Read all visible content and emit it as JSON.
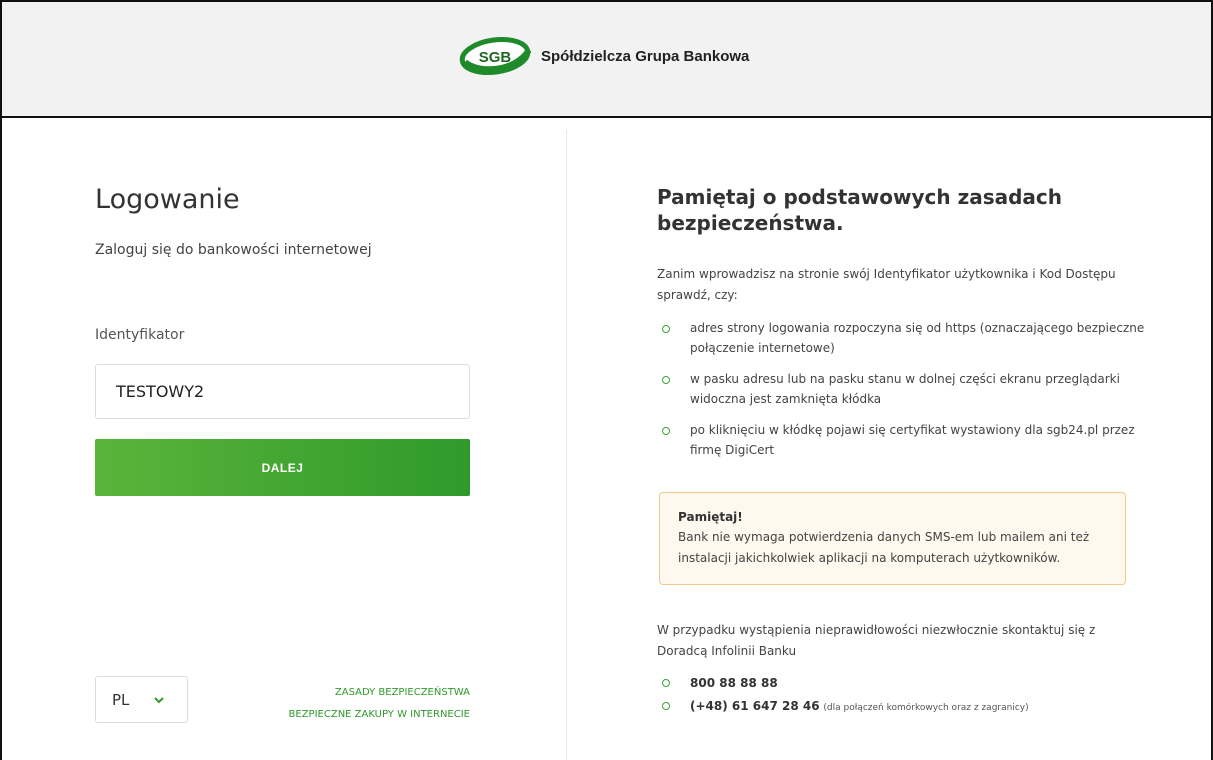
{
  "header": {
    "brand_logo_text": "SGB",
    "brand_name": "Spółdzielcza Grupa Bankowa"
  },
  "login": {
    "title": "Logowanie",
    "subtitle": "Zaloguj się do bankowości internetowej",
    "identifier_label": "Identyfikator",
    "identifier_value": "TESTOWY2",
    "submit_label": "DALEJ"
  },
  "language": {
    "selected": "PL",
    "chevron_icon": "chevron-down-icon"
  },
  "footer_links": [
    "ZASADY BEZPIECZEŃSTWA",
    "BEZPIECZNE ZAKUPY W INTERNECIE"
  ],
  "security": {
    "title": "Pamiętaj o podstawowych zasadach bezpieczeństwa.",
    "intro": "Zanim wprowadzisz na stronie swój Identyfikator użytkownika i Kod Dostępu sprawdź, czy:",
    "checks": [
      "adres strony logowania rozpoczyna się od https (oznaczającego bezpieczne połączenie internetowe)",
      "w pasku adresu lub na pasku stanu w dolnej części ekranu przeglądarki widoczna jest zamknięta kłódka",
      "po kliknięciu w kłódkę pojawi się certyfikat wystawiony dla sgb24.pl przez firmę DigiCert"
    ],
    "notice_title": "Pamiętaj!",
    "notice_text": "Bank nie wymaga potwierdzenia danych SMS-em lub mailem ani też instalacji jakichkolwiek aplikacji na komputerach użytkowników.",
    "contact_text": "W przypadku wystąpienia nieprawidłowości niezwłocznie skontaktuj się z Doradcą Infolinii Banku",
    "phone_1": "800 88 88 88",
    "phone_2": "(+48) 61 647 28 46",
    "phone_2_note": "(dla połączeń komórkowych oraz z zagranicy)"
  },
  "colors": {
    "accent_green": "#2f9a2b",
    "button_gradient_start": "#5ab43a",
    "notice_border": "#f3c98a",
    "header_bg": "#f2f2f2"
  }
}
